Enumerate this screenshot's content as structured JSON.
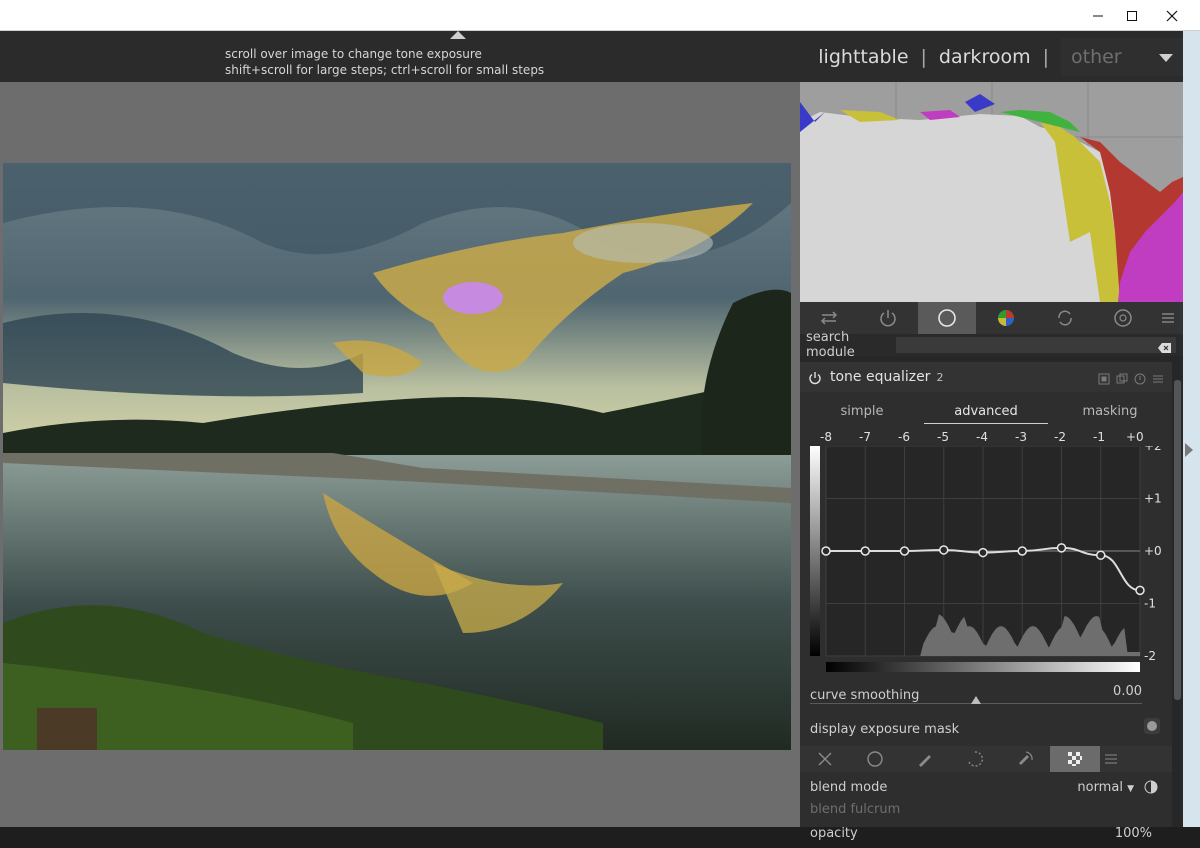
{
  "window": {
    "controls": [
      "minimize-icon",
      "maximize-icon",
      "close-icon"
    ]
  },
  "header": {
    "hint_line1": "scroll over image to change tone exposure",
    "hint_line2": "shift+scroll for large steps; ctrl+scroll for small steps",
    "views": [
      "lighttable",
      "darkroom",
      "other"
    ],
    "separator": "|"
  },
  "histogram": {
    "colors": {
      "gray": "#d6d6d6",
      "yellow": "#c9c03a",
      "red": "#b33830",
      "magenta": "#c03cc0",
      "green": "#3fb23f",
      "blue": "#3a3ac8"
    }
  },
  "module_groups": {
    "icons": [
      "sliders-icon",
      "power-icon",
      "circle-icon",
      "color-wheel-icon",
      "refresh-icon",
      "aperture-icon",
      "hamburger-icon"
    ],
    "active_index": 2
  },
  "search": {
    "label": "search module",
    "value": ""
  },
  "module": {
    "name": "tone equalizer",
    "instance": "2",
    "tabs": [
      "simple",
      "advanced",
      "masking"
    ],
    "active_tab": "advanced",
    "ev_ticks": [
      "-8",
      "-7",
      "-6",
      "-5",
      "-4",
      "-3",
      "-2",
      "-1",
      "+0"
    ],
    "y_ticks": [
      "+2",
      "+1",
      "+0",
      "-1",
      "-2"
    ],
    "curve_points_ev": [
      -8,
      -7,
      -6,
      -5,
      -4,
      -3,
      -2,
      -1,
      0
    ],
    "curve_values": [
      0.0,
      0.0,
      0.0,
      0.02,
      -0.03,
      0.0,
      0.06,
      -0.08,
      -0.75
    ],
    "curve_smoothing_label": "curve smoothing",
    "curve_smoothing_value": "0.00",
    "display_mask_label": "display exposure mask"
  },
  "mask_bar": {
    "icons": [
      "off-icon",
      "uniform-icon",
      "drawn-icon",
      "parametric-icon",
      "drawn-parametric-icon",
      "raster-icon",
      "hamburger-icon"
    ],
    "active_index": 5
  },
  "blend": {
    "mode_label": "blend mode",
    "mode_value": "normal",
    "fulcrum_label": "blend fulcrum",
    "opacity_label": "opacity",
    "opacity_value": "100%"
  }
}
